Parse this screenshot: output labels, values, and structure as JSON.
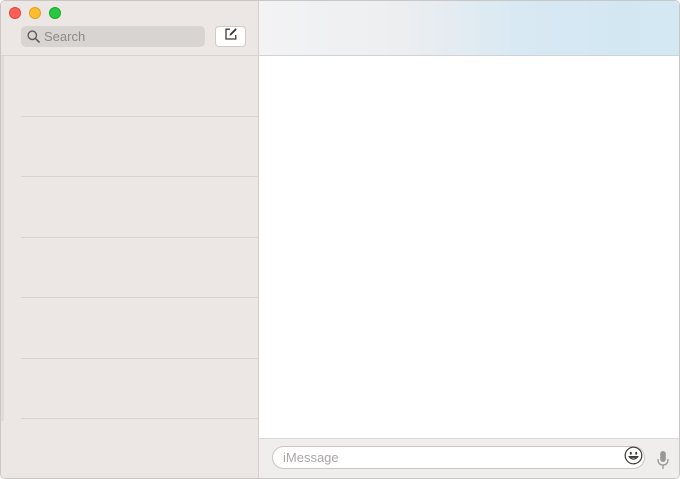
{
  "window": {
    "controls": [
      "close",
      "minimize",
      "zoom"
    ]
  },
  "sidebar": {
    "search": {
      "placeholder": "Search",
      "icon": "search-icon"
    },
    "compose_icon": "compose-icon",
    "conversations": [
      {},
      {},
      {},
      {},
      {},
      {}
    ]
  },
  "composer": {
    "placeholder": "iMessage",
    "emoji_icon": "emoji-icon",
    "mic_icon": "microphone-icon"
  },
  "colors": {
    "sidebar_bg": "#ece7e4",
    "header_gradient_end": "#d4e8f4",
    "close": "#fe5f57",
    "minimize": "#febc2e",
    "zoom": "#28c840"
  }
}
